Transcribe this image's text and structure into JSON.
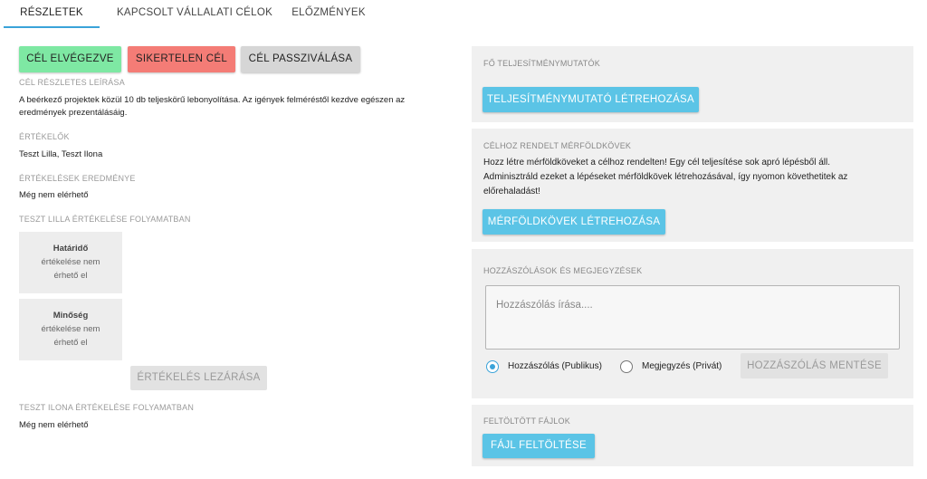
{
  "tabs": [
    {
      "label": "RÉSZLETEK"
    },
    {
      "label": "KAPCSOLT VÁLLALATI CÉLOK"
    },
    {
      "label": "ELŐZMÉNYEK"
    }
  ],
  "actions": {
    "complete": "CÉL ELVÉGEZVE",
    "failed": "SIKERTELEN CÉL",
    "passivate": "CÉL PASSZIVÁLÁSA"
  },
  "details": {
    "description_label": "CÉL RÉSZLETES LEÍRÁSA",
    "description": "A beérkező projektek közül 10 db teljeskörű lebonyolítása. Az igények felméréstől kezdve egészen az eredmények prezentálásáig.",
    "evaluators_label": "ÉRTÉKELŐK",
    "evaluators": "Teszt Lilla, Teszt Ilona",
    "results_label": "ÉRTÉKELÉSEK EREDMÉNYE",
    "results": "Még nem elérhető",
    "lilla_label": "TESZT LILLA ÉRTÉKELÉSE FOLYAMATBAN",
    "eval_items": [
      {
        "title": "Határidő",
        "line1": "értékelése nem",
        "line2": "érhető el"
      },
      {
        "title": "Minőség",
        "line1": "értékelése nem",
        "line2": "érhető el"
      }
    ],
    "close_eval": "ÉRTÉKELÉS LEZÁRÁSA",
    "ilona_label": "TESZT ILONA ÉRTÉKELÉSE FOLYAMATBAN",
    "ilona_status": "Még nem elérhető"
  },
  "kpi": {
    "label": "FŐ TELJESÍTMÉNYMUTATÓK",
    "button": "TELJESÍTMÉNYMUTATÓ LÉTREHOZÁSA"
  },
  "milestones": {
    "label": "CÉLHOZ RENDELT MÉRFÖLDKÖVEK",
    "line1": "Hozz létre mérföldköveket a célhoz rendelten! Egy cél teljesítése sok apró lépésből áll.",
    "line2": "Adminisztráld ezeket a lépéseket mérföldkövek létrehozásával, így nyomon követhetitek az",
    "line3": "előrehaladást!",
    "button": "MÉRFÖLDKÖVEK LÉTREHOZÁSA"
  },
  "comments": {
    "label": "HOZZÁSZÓLÁSOK ÉS MEGJEGYZÉSEK",
    "placeholder": "Hozzászólás írása....",
    "public_label": "Hozzászólás (Publikus)",
    "private_label": "Megjegyzés (Privát)",
    "save": "HOZZÁSZÓLÁS MENTÉSE",
    "selected": "public",
    "accent_color": "#3aa3d9"
  },
  "files": {
    "label": "FELTÖLTÖTT FÁJLOK",
    "button": "FÁJL FELTÖLTÉSE"
  }
}
